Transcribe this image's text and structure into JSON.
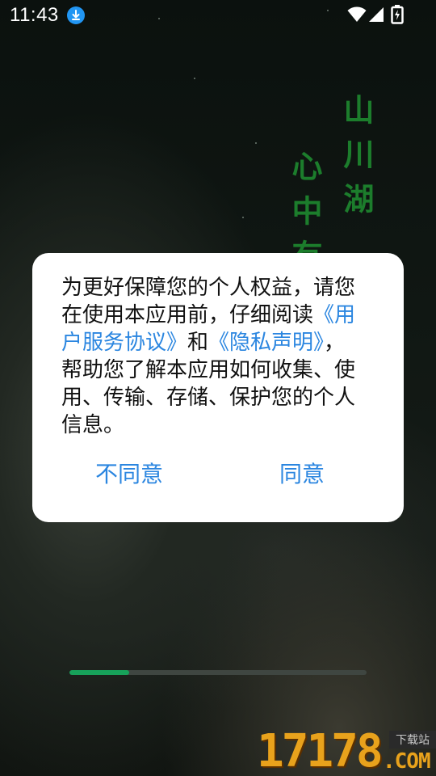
{
  "status_bar": {
    "time": "11:43",
    "icons": [
      "download-icon",
      "wifi-icon",
      "signal-icon",
      "battery-charging-icon"
    ]
  },
  "background": {
    "poem_columns": [
      "山川湖",
      "心中有"
    ]
  },
  "dialog": {
    "text_before": "为更好保障您的个人权益，请您在使用本应用前，仔细阅读",
    "link_terms": "《用户服务协议》",
    "text_and": "和",
    "link_privacy": "《隐私声明》",
    "text_after": "，帮助您了解本应用如何收集、使用、传输、存储、保护您的个人信息。",
    "button_disagree": "不同意",
    "button_agree": "同意",
    "colors": {
      "link": "#2b86e0",
      "text": "#111111",
      "background": "#ffffff"
    }
  },
  "progress": {
    "fraction": 0.2,
    "color": "#17a25a"
  },
  "watermark": {
    "number": "17178",
    "site_label": "下载站",
    "domain": ".COM"
  }
}
